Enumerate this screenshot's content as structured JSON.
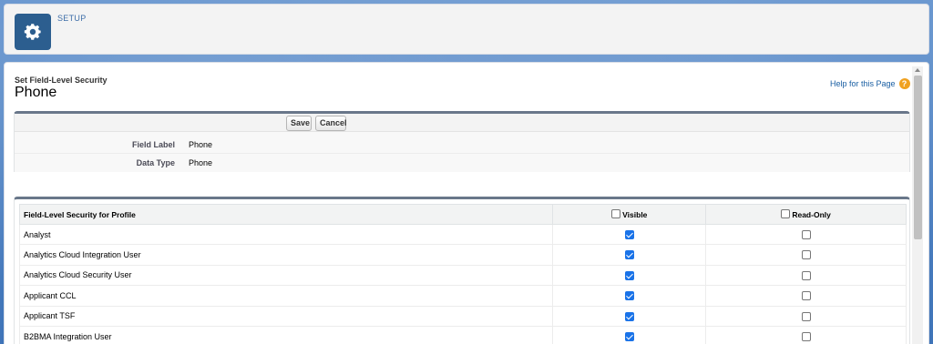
{
  "header": {
    "app_label": "SETUP",
    "icon": "gear-icon"
  },
  "page": {
    "subtitle": "Set Field-Level Security",
    "title": "Phone",
    "help_link": "Help for this Page"
  },
  "toolbar": {
    "save_label": "Save",
    "cancel_label": "Cancel"
  },
  "details": [
    {
      "label": "Field Label",
      "value": "Phone"
    },
    {
      "label": "Data Type",
      "value": "Phone"
    }
  ],
  "table": {
    "columns": [
      "Field-Level Security for Profile",
      "Visible",
      "Read-Only"
    ],
    "rows": [
      {
        "profile": "Analyst",
        "visible": true,
        "read_only": false
      },
      {
        "profile": "Analytics Cloud Integration User",
        "visible": true,
        "read_only": false
      },
      {
        "profile": "Analytics Cloud Security User",
        "visible": true,
        "read_only": false
      },
      {
        "profile": "Applicant CCL",
        "visible": true,
        "read_only": false
      },
      {
        "profile": "Applicant TSF",
        "visible": true,
        "read_only": false
      },
      {
        "profile": "B2BMA Integration User",
        "visible": true,
        "read_only": false
      }
    ]
  },
  "colors": {
    "accent": "#1a73e8",
    "header_tile": "#2c5e8f",
    "link": "#1a5fa3"
  }
}
